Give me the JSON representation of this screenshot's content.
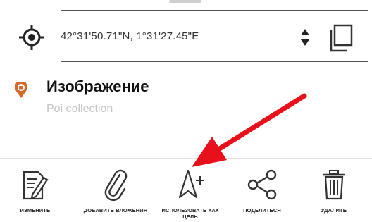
{
  "coordinates": {
    "text": "42°31'50.71\"N, 1°31'27.45\"E"
  },
  "poi": {
    "title": "Изображение",
    "subtitle": "Poi collection"
  },
  "actions": [
    {
      "label": "ИЗМЕНИТЬ",
      "icon": "edit-icon"
    },
    {
      "label": "ДОБАВИТЬ ВЛОЖЕНИЯ",
      "icon": "paperclip-icon"
    },
    {
      "label": "ИСПОЛЬЗОВАТЬ КАК ЦЕЛЬ",
      "icon": "navigate-target-icon"
    },
    {
      "label": "ПОДЕЛИТЬСЯ",
      "icon": "share-icon"
    },
    {
      "label": "УДАЛИТЬ",
      "icon": "trash-icon"
    }
  ],
  "colors": {
    "accent": "#e8111b",
    "poi_marker": "#d46a2a",
    "text": "#222222"
  }
}
